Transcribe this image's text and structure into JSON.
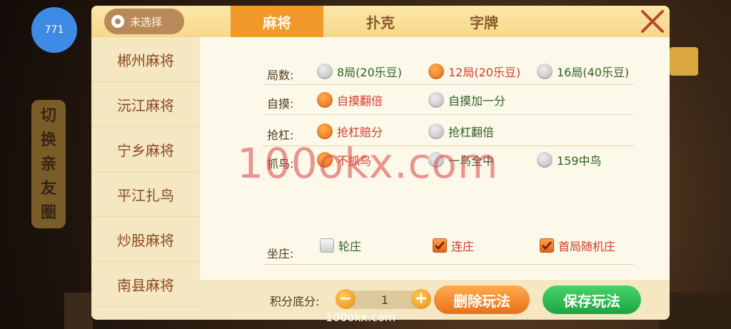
{
  "avatar_badge": "771",
  "location": {
    "label": "未选择"
  },
  "tabs": [
    {
      "label": "麻将",
      "active": true
    },
    {
      "label": "扑克",
      "active": false
    },
    {
      "label": "字牌",
      "active": false
    }
  ],
  "sidebar": {
    "items": [
      "郴州麻将",
      "沅江麻将",
      "宁乡麻将",
      "平江扎鸟",
      "炒股麻将",
      "南县麻将"
    ]
  },
  "background": {
    "side_banner": [
      "切",
      "换",
      "亲",
      "友",
      "圈"
    ]
  },
  "rules": {
    "rounds": {
      "label": "局数:",
      "options": [
        {
          "text": "8局(20乐豆)",
          "selected": false
        },
        {
          "text": "12局(20乐豆)",
          "selected": true
        },
        {
          "text": "16局(40乐豆)",
          "selected": false
        }
      ]
    },
    "self_draw": {
      "label": "自摸:",
      "options": [
        {
          "text": "自摸翻倍",
          "selected": true
        },
        {
          "text": "自摸加一分",
          "selected": false
        }
      ]
    },
    "rob_kong": {
      "label": "抢杠:",
      "options": [
        {
          "text": "抢杠赔分",
          "selected": true
        },
        {
          "text": "抢杠翻倍",
          "selected": false
        }
      ]
    },
    "catch_bird": {
      "label": "抓鸟:",
      "options": [
        {
          "text": "不抓鸟",
          "selected": true
        },
        {
          "text": "一鸟全中",
          "selected": false
        },
        {
          "text": "159中鸟",
          "selected": false
        }
      ]
    },
    "dealer": {
      "label": "坐庄:",
      "options": [
        {
          "text": "轮庄",
          "checked": false
        },
        {
          "text": "连庄",
          "checked": true
        },
        {
          "text": "首局随机庄",
          "checked": true
        }
      ]
    }
  },
  "footer": {
    "score_label": "积分底分:",
    "score_value": "1",
    "minus_symbol": "−",
    "plus_symbol": "+",
    "delete_label": "删除玩法",
    "save_label": "保存玩法"
  },
  "watermark": "100okx.com",
  "bottom_url": "100okx.com",
  "colors": {
    "accent_orange": "#f19a2b",
    "selected_text": "#d43a2a",
    "unselected_text": "#2e5e28",
    "save_green": "#1da442"
  }
}
